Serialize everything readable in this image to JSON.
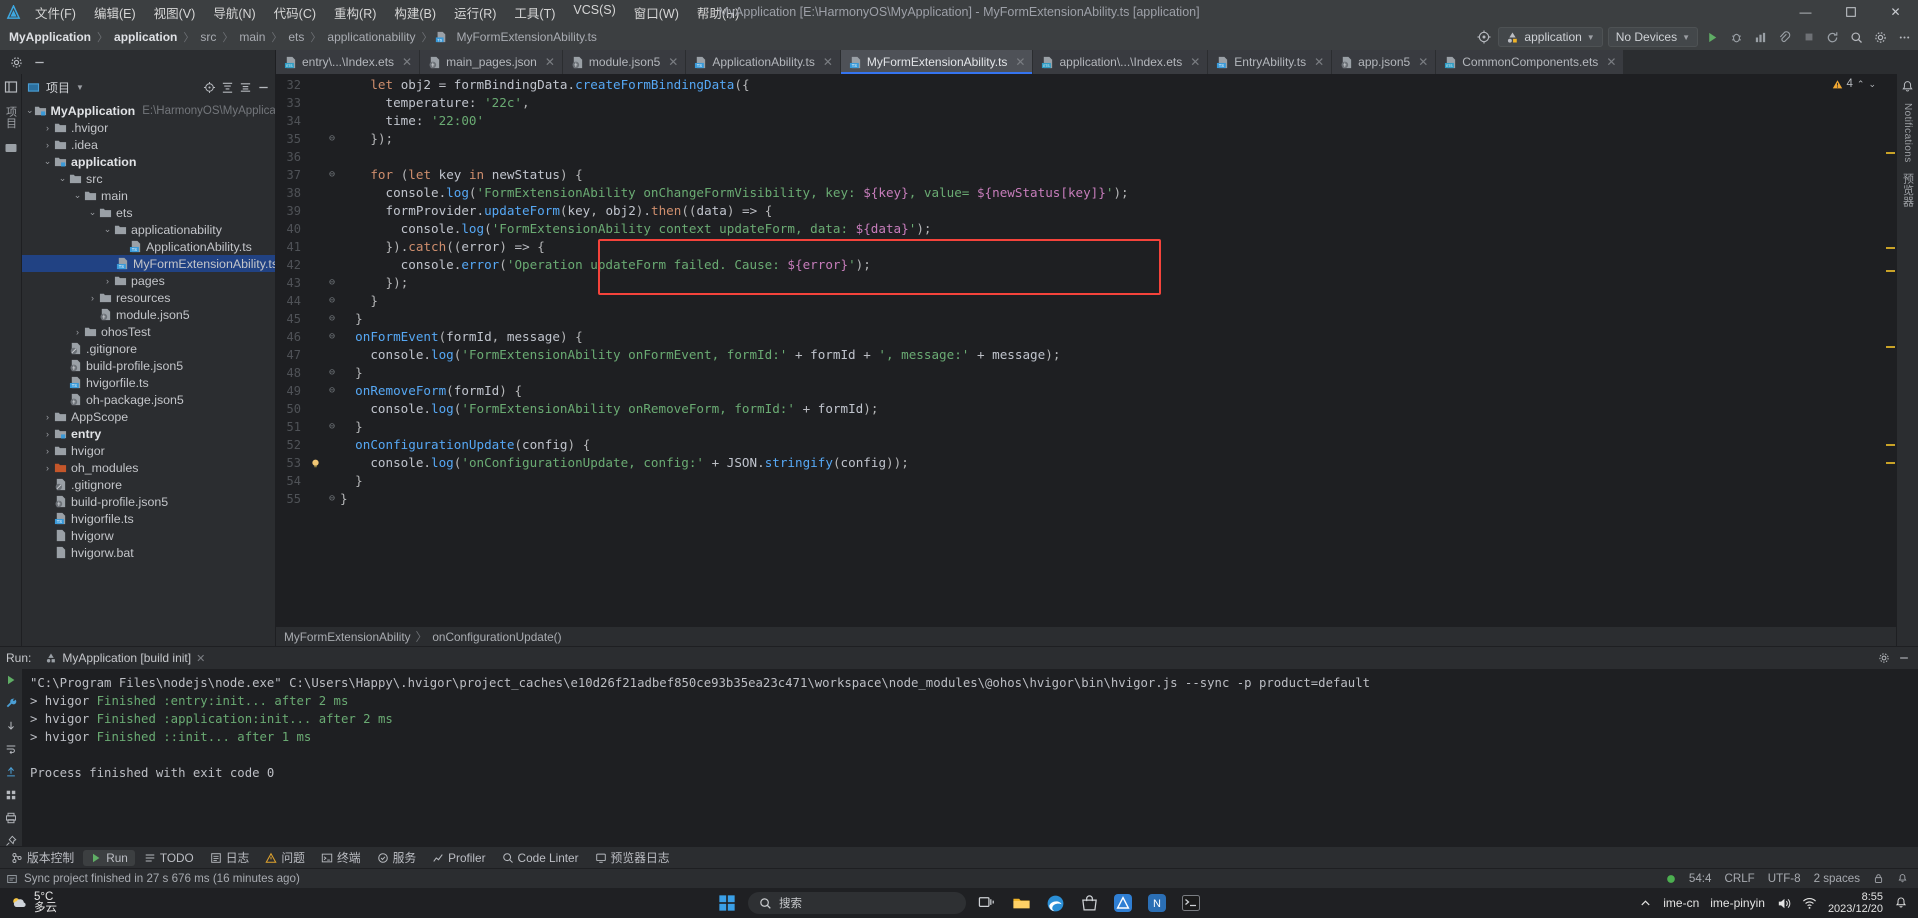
{
  "window": {
    "title": "MyApplication [E:\\HarmonyOS\\MyApplication] - MyFormExtensionAbility.ts [application]",
    "minimize": "—",
    "maximize": "❐",
    "close": "✕"
  },
  "menu": {
    "items": [
      "文件(F)",
      "编辑(E)",
      "视图(V)",
      "导航(N)",
      "代码(C)",
      "重构(R)",
      "构建(B)",
      "运行(R)",
      "工具(T)",
      "VCS(S)",
      "窗口(W)",
      "帮助(H)"
    ]
  },
  "breadcrumb": {
    "items": [
      {
        "label": "MyApplication",
        "bold": true
      },
      {
        "label": "application",
        "bold": true
      },
      {
        "label": "src",
        "bold": false
      },
      {
        "label": "main",
        "bold": false
      },
      {
        "label": "ets",
        "bold": false
      },
      {
        "label": "applicationability",
        "bold": false
      },
      {
        "label": "MyFormExtensionAbility.ts",
        "bold": false
      }
    ],
    "separator": "〉"
  },
  "toolbar": {
    "run_config": "application",
    "device": "No Devices",
    "target_icon": "target-icon",
    "run_icon": "run-icon",
    "debug_icon": "debug-icon",
    "profile_icon": "profiler-icon",
    "attach_icon": "attach-icon",
    "stop_icon": "stop-icon",
    "update_icon": "update-icon",
    "search_icon": "search-icon",
    "settings_icon": "gear-icon",
    "more_icon": "more-icon"
  },
  "tabs": {
    "gear_label": "gear-icon",
    "minus_label": "minus-icon",
    "items": [
      {
        "label": "entry\\...\\Index.ets",
        "kind": "ETS",
        "active": false
      },
      {
        "label": "main_pages.json",
        "kind": "JSON",
        "active": false
      },
      {
        "label": "module.json5",
        "kind": "JSON",
        "active": false
      },
      {
        "label": "ApplicationAbility.ts",
        "kind": "TS",
        "active": false
      },
      {
        "label": "MyFormExtensionAbility.ts",
        "kind": "TS",
        "active": true
      },
      {
        "label": "application\\...\\Index.ets",
        "kind": "ETS",
        "active": false
      },
      {
        "label": "EntryAbility.ts",
        "kind": "TS",
        "active": false
      },
      {
        "label": "app.json5",
        "kind": "JSON",
        "active": false
      },
      {
        "label": "CommonComponents.ets",
        "kind": "ETS",
        "active": false
      }
    ]
  },
  "project_panel": {
    "title": "项目",
    "dropdown_icon": "chevron-down-icon",
    "locate_icon": "locate-icon",
    "expand_icon": "expand-all-icon",
    "collapse_icon": "collapse-all-icon",
    "hide_icon": "hide-icon",
    "tree": [
      {
        "depth": 0,
        "arrow": "⌄",
        "icon": "module-folder",
        "label": "MyApplication",
        "bold": true,
        "path": "E:\\HarmonyOS\\MyApplication",
        "selected": false
      },
      {
        "depth": 1,
        "arrow": "›",
        "icon": "folder",
        "label": ".hvigor",
        "bold": false,
        "path": "",
        "selected": false
      },
      {
        "depth": 1,
        "arrow": "›",
        "icon": "folder",
        "label": ".idea",
        "bold": false,
        "path": "",
        "selected": false
      },
      {
        "depth": 1,
        "arrow": "⌄",
        "icon": "module-folder",
        "label": "application",
        "bold": true,
        "path": "",
        "selected": false
      },
      {
        "depth": 2,
        "arrow": "⌄",
        "icon": "folder",
        "label": "src",
        "bold": false,
        "path": "",
        "selected": false
      },
      {
        "depth": 3,
        "arrow": "⌄",
        "icon": "folder",
        "label": "main",
        "bold": false,
        "path": "",
        "selected": false
      },
      {
        "depth": 4,
        "arrow": "⌄",
        "icon": "folder",
        "label": "ets",
        "bold": false,
        "path": "",
        "selected": false
      },
      {
        "depth": 5,
        "arrow": "⌄",
        "icon": "folder",
        "label": "applicationability",
        "bold": false,
        "path": "",
        "selected": false
      },
      {
        "depth": 6,
        "arrow": "",
        "icon": "ts-file",
        "label": "ApplicationAbility.ts",
        "bold": false,
        "path": "",
        "selected": false
      },
      {
        "depth": 6,
        "arrow": "",
        "icon": "ts-file",
        "label": "MyFormExtensionAbility.ts",
        "bold": false,
        "path": "",
        "selected": true
      },
      {
        "depth": 5,
        "arrow": "›",
        "icon": "folder",
        "label": "pages",
        "bold": false,
        "path": "",
        "selected": false
      },
      {
        "depth": 4,
        "arrow": "›",
        "icon": "folder",
        "label": "resources",
        "bold": false,
        "path": "",
        "selected": false
      },
      {
        "depth": 4,
        "arrow": "",
        "icon": "json-file",
        "label": "module.json5",
        "bold": false,
        "path": "",
        "selected": false
      },
      {
        "depth": 3,
        "arrow": "›",
        "icon": "folder",
        "label": "ohosTest",
        "bold": false,
        "path": "",
        "selected": false
      },
      {
        "depth": 2,
        "arrow": "",
        "icon": "git-file",
        "label": ".gitignore",
        "bold": false,
        "path": "",
        "selected": false
      },
      {
        "depth": 2,
        "arrow": "",
        "icon": "json-file",
        "label": "build-profile.json5",
        "bold": false,
        "path": "",
        "selected": false
      },
      {
        "depth": 2,
        "arrow": "",
        "icon": "ts-file",
        "label": "hvigorfile.ts",
        "bold": false,
        "path": "",
        "selected": false
      },
      {
        "depth": 2,
        "arrow": "",
        "icon": "json-file",
        "label": "oh-package.json5",
        "bold": false,
        "path": "",
        "selected": false
      },
      {
        "depth": 1,
        "arrow": "›",
        "icon": "folder",
        "label": "AppScope",
        "bold": false,
        "path": "",
        "selected": false
      },
      {
        "depth": 1,
        "arrow": "›",
        "icon": "module-folder",
        "label": "entry",
        "bold": true,
        "path": "",
        "selected": false
      },
      {
        "depth": 1,
        "arrow": "›",
        "icon": "folder",
        "label": "hvigor",
        "bold": false,
        "path": "",
        "selected": false
      },
      {
        "depth": 1,
        "arrow": "›",
        "icon": "lib-folder",
        "label": "oh_modules",
        "bold": false,
        "path": "",
        "selected": false
      },
      {
        "depth": 1,
        "arrow": "",
        "icon": "git-file",
        "label": ".gitignore",
        "bold": false,
        "path": "",
        "selected": false
      },
      {
        "depth": 1,
        "arrow": "",
        "icon": "json-file",
        "label": "build-profile.json5",
        "bold": false,
        "path": "",
        "selected": false
      },
      {
        "depth": 1,
        "arrow": "",
        "icon": "ts-file",
        "label": "hvigorfile.ts",
        "bold": false,
        "path": "",
        "selected": false
      },
      {
        "depth": 1,
        "arrow": "",
        "icon": "file",
        "label": "hvigorw",
        "bold": false,
        "path": "",
        "selected": false
      },
      {
        "depth": 1,
        "arrow": "",
        "icon": "file",
        "label": "hvigorw.bat",
        "bold": false,
        "path": "",
        "selected": false
      }
    ]
  },
  "side_tabs": {
    "left": [
      "项目",
      "结构"
    ],
    "right": [
      "Notifications",
      "预览器"
    ]
  },
  "editor": {
    "warning_count": "4",
    "warning_icon": "warning-icon",
    "up_icon": "chevron-up-icon",
    "down_icon": "chevron-down-icon",
    "breadcrumb_bottom": [
      "MyFormExtensionAbility",
      "onConfigurationUpdate()"
    ],
    "breadcrumb_sep": "〉",
    "lines": [
      {
        "n": "32",
        "fold": "",
        "bp": "",
        "text": "    let obj2 = formBindingData.createFormBindingData({"
      },
      {
        "n": "33",
        "fold": "",
        "bp": "",
        "text": "      temperature: '22c',"
      },
      {
        "n": "34",
        "fold": "",
        "bp": "",
        "text": "      time: '22:00'"
      },
      {
        "n": "35",
        "fold": "⊖",
        "bp": "",
        "text": "    });"
      },
      {
        "n": "36",
        "fold": "",
        "bp": "",
        "text": ""
      },
      {
        "n": "37",
        "fold": "⊖",
        "bp": "",
        "text": "    for (let key in newStatus) {"
      },
      {
        "n": "38",
        "fold": "",
        "bp": "",
        "text": "      console.log('FormExtensionAbility onChangeFormVisibility, key: ${key}, value= ${newStatus[key]}');"
      },
      {
        "n": "39",
        "fold": "",
        "bp": "",
        "text": "      formProvider.updateForm(key, obj2).then((data) => {"
      },
      {
        "n": "40",
        "fold": "",
        "bp": "",
        "text": "        console.log('FormExtensionAbility context updateForm, data: ${data}');"
      },
      {
        "n": "41",
        "fold": "",
        "bp": "",
        "text": "      }).catch((error) => {"
      },
      {
        "n": "42",
        "fold": "",
        "bp": "",
        "text": "        console.error('Operation updateForm failed. Cause: ${error}');"
      },
      {
        "n": "43",
        "fold": "⊖",
        "bp": "",
        "text": "      });"
      },
      {
        "n": "44",
        "fold": "⊖",
        "bp": "",
        "text": "    }"
      },
      {
        "n": "45",
        "fold": "⊖",
        "bp": "",
        "text": "  }"
      },
      {
        "n": "46",
        "fold": "⊖",
        "bp": "",
        "text": "  onFormEvent(formId, message) {"
      },
      {
        "n": "47",
        "fold": "",
        "bp": "",
        "text": "    console.log('FormExtensionAbility onFormEvent, formId:' + formId + ', message:' + message);"
      },
      {
        "n": "48",
        "fold": "⊖",
        "bp": "",
        "text": "  }"
      },
      {
        "n": "49",
        "fold": "⊖",
        "bp": "",
        "text": "  onRemoveForm(formId) {"
      },
      {
        "n": "50",
        "fold": "",
        "bp": "",
        "text": "    console.log('FormExtensionAbility onRemoveForm, formId:' + formId);"
      },
      {
        "n": "51",
        "fold": "⊖",
        "bp": "",
        "text": "  }"
      },
      {
        "n": "52",
        "fold": "",
        "bp": "",
        "text": "  onConfigurationUpdate(config) {"
      },
      {
        "n": "53",
        "fold": "",
        "bp": "bulb",
        "text": "    console.log('onConfigurationUpdate, config:' + JSON.stringify(config));"
      },
      {
        "n": "54",
        "fold": "",
        "bp": "",
        "text": "  }"
      },
      {
        "n": "55",
        "fold": "⊖",
        "bp": "",
        "text": "}"
      }
    ],
    "highlight_color": "#f5433b"
  },
  "run_panel": {
    "label": "Run:",
    "config_name": "MyApplication [build init]",
    "close_icon": "close-icon",
    "settings_icon": "gear-icon",
    "minimize_icon": "minimize-icon",
    "side_icons": [
      "run-icon",
      "wrench-icon",
      "down-icon",
      "wrap-icon",
      "export-icon",
      "grid-icon",
      "print-icon",
      "pin-icon",
      "trash-icon"
    ],
    "console_lines": [
      {
        "text": "\"C:\\Program Files\\nodejs\\node.exe\" C:\\Users\\Happy\\.hvigor\\project_caches\\e10d26f21adbef850ce93b35ea23c471\\workspace\\node_modules\\@ohos\\hvigor\\bin\\hvigor.js --sync -p product=default",
        "color": "gray"
      },
      {
        "text": "> hvigor Finished :entry:init... after 2 ms",
        "color": "green"
      },
      {
        "text": "> hvigor Finished :application:init... after 2 ms",
        "color": "green"
      },
      {
        "text": "> hvigor Finished ::init... after 1 ms",
        "color": "green"
      },
      {
        "text": "",
        "color": "gray"
      },
      {
        "text": "Process finished with exit code 0",
        "color": "gray"
      }
    ]
  },
  "tool_strip": {
    "items": [
      {
        "label": "版本控制",
        "icon": "vcs-icon"
      },
      {
        "label": "Run",
        "icon": "run-icon",
        "active": true
      },
      {
        "label": "TODO",
        "icon": "todo-icon"
      },
      {
        "label": "日志",
        "icon": "log-icon"
      },
      {
        "label": "问题",
        "icon": "problems-icon"
      },
      {
        "label": "终端",
        "icon": "terminal-icon"
      },
      {
        "label": "服务",
        "icon": "services-icon"
      },
      {
        "label": "Profiler",
        "icon": "profiler-icon"
      },
      {
        "label": "Code Linter",
        "icon": "linter-icon"
      },
      {
        "label": "预览器日志",
        "icon": "previewer-log-icon"
      }
    ]
  },
  "status_bar": {
    "message": "Sync project finished in 27 s 676 ms (16 minutes ago)",
    "message_icon": "info-icon",
    "caret": "54:4",
    "line_ending": "CRLF",
    "encoding": "UTF-8",
    "indent": "2 spaces",
    "lock_icon": "lock-icon",
    "bell_icon": "bell-icon",
    "status_dot_color": "#4caf50"
  },
  "taskbar": {
    "weather_temp": "5°C",
    "weather_desc": "多云",
    "search_placeholder": "搜索",
    "search_icon": "search-icon",
    "start_icon": "windows-icon",
    "apps": [
      "task-view-icon",
      "file-explorer-icon",
      "edge-icon",
      "store-icon",
      "deveco-icon",
      "app-n-icon",
      "terminal-icon"
    ],
    "tray": [
      "chevron-up-icon",
      "ime-cn",
      "ime-pinyin",
      "speaker-icon",
      "network-icon"
    ],
    "time": "8:55",
    "date": "2023/12/20",
    "notification_icon": "notification-icon"
  }
}
